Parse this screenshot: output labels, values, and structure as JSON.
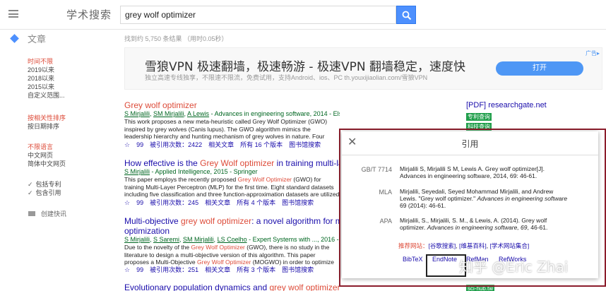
{
  "header": {
    "brand": "学术搜索",
    "search_value": "grey wolf optimizer"
  },
  "sidebar": {
    "section": "文章",
    "time_filters": [
      "时间不限",
      "2019以来",
      "2018以来",
      "2015以来",
      "自定义范围..."
    ],
    "sort_options": [
      "按相关性排序",
      "按日期排序"
    ],
    "language_options": [
      "不限语言",
      "中文网页",
      "简体中文网页"
    ],
    "checkboxes": [
      "包括专利",
      "包含引用"
    ],
    "alert": "创建快讯"
  },
  "stats": "找到约 5,750 条结果 （用时0.05秒）",
  "ad": {
    "tag": "广告▸",
    "title": "雪狼VPN 极速翻墙，极速畅游 - 极速VPN 翻墙稳定，速度快",
    "desc": "独立高速专线独享，不限速不限流，免费试用，支持Android、ios、PC th.youxijiaolian.com/雪狼VPN",
    "button": "打开"
  },
  "results": [
    {
      "title_parts": [
        "Grey wolf optimizer"
      ],
      "authors": [
        "S Mirjalili",
        "SM Mirjalili",
        "A Lewis"
      ],
      "venue": " - Advances in engineering software, 2014 - Elsevier",
      "snippet": "This work proposes a new meta-heuristic called Grey Wolf Optimizer (GWO) inspired by grey wolves (Canis lupus). The GWO algorithm mimics the leadership hierarchy and hunting mechanism of grey wolves in nature. Four types of grey wolves such as alpha",
      "actions": [
        "☆",
        "99",
        "被引用次数：2422",
        "相关文章",
        "所有 16 个版本",
        "图书馆搜索"
      ]
    },
    {
      "title_pre": "How effective is the ",
      "title_hl": "Grey Wolf optimizer",
      "title_post": " in training multi-layer",
      "authors": [
        "S Mirjalili"
      ],
      "venue": " - Applied Intelligence, 2015 - Springer",
      "snippet_pre": "This paper employs the recently proposed ",
      "snippet_hl": "Grey Wolf Optimizer",
      "snippet_post": " (GWO) for training Multi-Layer Perceptron (MLP) for the first time. Eight standard datasets including five classification and three function-approximation datasets are utilized to benchmark the performance",
      "actions": [
        "☆",
        "99",
        "被引用次数：245",
        "相关文章",
        "所有 4 个版本",
        "图书馆搜索"
      ]
    },
    {
      "title_pre": "Multi-objective ",
      "title_hl": "grey wolf optimizer",
      "title_post": ": a novel algorithm for multi-criterion",
      "title_line2": "optimization",
      "authors": [
        "S Mirjalili",
        "S Saremi",
        "SM Mirjalili",
        "LS Coelho"
      ],
      "venue": " - Expert Systems with ..., 2016 - Elsevier",
      "snippet_pre": "Due to the novelty of the ",
      "snippet_hl": "Grey Wolf Optimizer",
      "snippet_mid": " (GWO), there is no study in the literature to design a multi-objective version of this algorithm. This paper proposes a Multi-Objective ",
      "snippet_hl2": "Grey Wolf Optimizer",
      "snippet_post": " (MOGWO) in order to optimize problems with multiple objectives",
      "actions": [
        "☆",
        "99",
        "被引用次数：251",
        "相关文章",
        "所有 3 个版本",
        "图书馆搜索"
      ]
    },
    {
      "title_pre": "Evolutionary population dynamics and ",
      "title_hl": "grey wolf optimizer"
    }
  ],
  "right_links": {
    "pdf_label": "[PDF]",
    "pdf_site": "researchgate.net",
    "tags": [
      "专利查询",
      "科技查询",
      "sci-hub.tw"
    ]
  },
  "cite": {
    "title": "引用",
    "close": "✕",
    "formats": [
      {
        "name": "GB/T 7714",
        "text": "Mirjalili S, Mirjalili S M, Lewis A. Grey wolf optimizer[J]. Advances in engineering software, 2014, 69: 46-61."
      },
      {
        "name": "MLA",
        "text_pre": "Mirjalili, Seyedali, Seyed Mohammad Mirjalili, and Andrew Lewis. \"Grey wolf optimizer.\" ",
        "text_it": "Advances in engineering software",
        "text_post": " 69 (2014): 46-61."
      },
      {
        "name": "APA",
        "text_pre": "Mirjalili, S., Mirjalili, S. M., & Lewis, A. (2014). Grey wolf optimizer. ",
        "text_it": "Advances in engineering software, 69",
        "text_post": ", 46-61."
      }
    ],
    "links_label": "推荐网站：",
    "links": [
      "[谷歌搜索]",
      "[维基百科]",
      "[学术网站集合]"
    ],
    "exports": [
      "BibTeX",
      "EndNote",
      "RefMan",
      "RefWorks"
    ]
  },
  "watermark": "知乎 @Eric Zhai",
  "colors": {
    "link": "#1a0dab",
    "highlight": "#dd4b39",
    "author": "#006621",
    "accent": "#4d90fe",
    "dialog_border": "#8b1c2b"
  }
}
